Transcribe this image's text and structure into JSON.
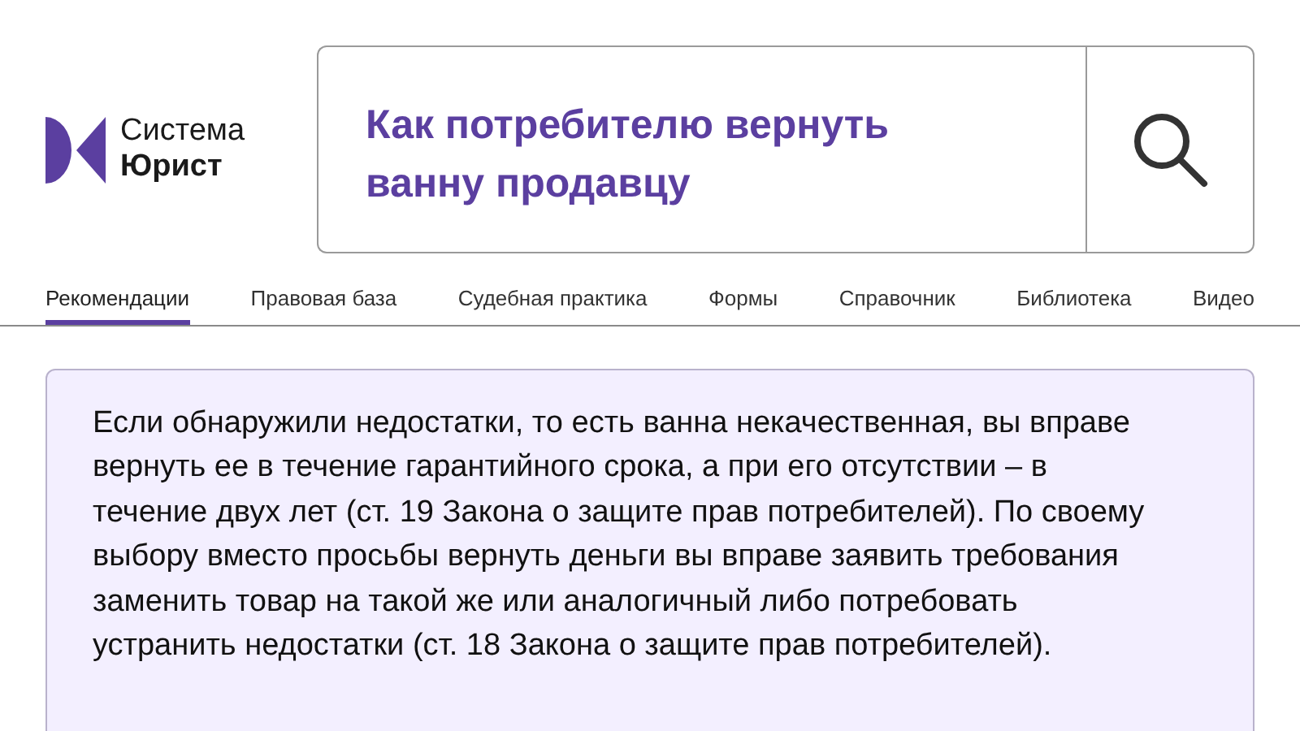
{
  "logo": {
    "line_1": "Система",
    "line_2": "Юрист"
  },
  "search": {
    "value": "Как потребителю вернуть ванну продавцу"
  },
  "tabs": [
    {
      "label": "Рекомендации",
      "selected": true
    },
    {
      "label": "Правовая база",
      "selected": false
    },
    {
      "label": "Судебная практика",
      "selected": false
    },
    {
      "label": "Формы",
      "selected": false
    },
    {
      "label": "Справочник",
      "selected": false
    },
    {
      "label": "Библиотека",
      "selected": false
    },
    {
      "label": "Видео",
      "selected": false
    }
  ],
  "answer": {
    "text": "Если обнаружили недостатки, то есть ванна некачественная, вы вправе вернуть ее в течение гарантийного срока, а при его отсутствии – в течение двух лет (ст. 19 Закона о защите прав потребителей). По своему выбору вместо просьбы вернуть деньги вы вправе заявить требования заменить товар на такой же или аналогичный либо потребовать устранить недостатки (ст. 18 Закона о защите прав потребителей)."
  }
}
